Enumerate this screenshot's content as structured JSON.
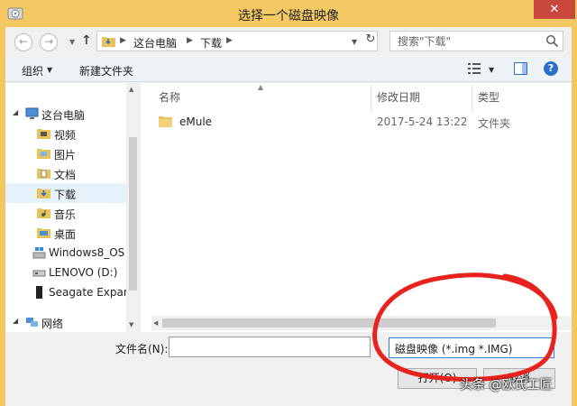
{
  "window": {
    "title": "选择一个磁盘映像",
    "close_glyph": "✕"
  },
  "address": {
    "breadcrumbs": [
      "这台电脑",
      "下载"
    ],
    "search_placeholder": "搜索\"下载\""
  },
  "toolbar": {
    "organize": "组织",
    "new_folder": "新建文件夹"
  },
  "nav": {
    "items": [
      {
        "label": "这台电脑",
        "icon": "computer-icon"
      },
      {
        "label": "视频",
        "icon": "video-folder-icon"
      },
      {
        "label": "图片",
        "icon": "pictures-folder-icon"
      },
      {
        "label": "文档",
        "icon": "documents-folder-icon"
      },
      {
        "label": "下载",
        "icon": "downloads-folder-icon"
      },
      {
        "label": "音乐",
        "icon": "music-folder-icon"
      },
      {
        "label": "桌面",
        "icon": "desktop-folder-icon"
      },
      {
        "label": "Windows8_OS (",
        "icon": "windows-drive-icon"
      },
      {
        "label": "LENOVO (D:)",
        "icon": "hard-drive-icon"
      },
      {
        "label": "Seagate Expans",
        "icon": "external-drive-icon"
      },
      {
        "label": "网络",
        "icon": "network-icon"
      }
    ],
    "selected_index": 4
  },
  "files": {
    "columns": [
      "名称",
      "修改日期",
      "类型"
    ],
    "rows": [
      {
        "name": "eMule",
        "date": "2017-5-24 13:22",
        "type": "文件夹"
      }
    ]
  },
  "bottom": {
    "filename_label": "文件名(N):",
    "filename_value": "",
    "filetype_value": "磁盘映像 (*.img *.IMG)",
    "open_label": "打开(O)",
    "cancel_label": "取消"
  },
  "colors": {
    "title_bar": "#f4c862",
    "close_button": "#c9483d",
    "annotation": "#e8221c"
  },
  "watermark": "头条 @欧氏工匠"
}
